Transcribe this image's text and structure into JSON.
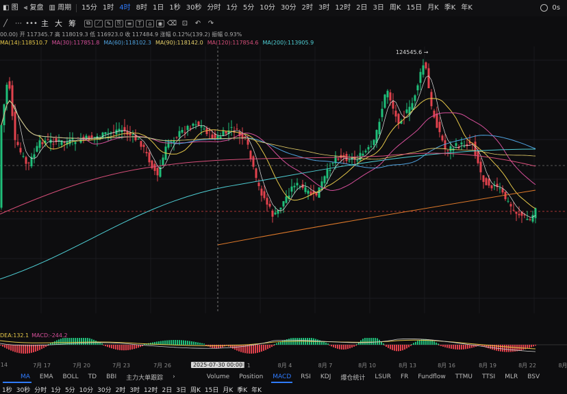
{
  "topbar": {
    "left_items": [
      "图",
      "复盘",
      "周期",
      "15分",
      "1时",
      "4时",
      "8时",
      "1日",
      "1秒",
      "30秒",
      "分时",
      "1分",
      "5分",
      "10分",
      "30分",
      "2时",
      "3时",
      "12时",
      "2日",
      "3日",
      "周K",
      "15日",
      "月K",
      "季K",
      "年K"
    ],
    "active": "4时",
    "right": "0s"
  },
  "toolbar": {
    "text_tools": [
      "主",
      "大",
      "筹"
    ]
  },
  "ohlc_line": "00.00) 开 117345.7 高 118019.3 低 116923.0 收 117484.9 涨幅 0.12%(139.2) 振幅 0.93%",
  "ma_legend": [
    {
      "label": "MA(14):118510.7",
      "color": "#e6c84a"
    },
    {
      "label": "MA(30):117851.8",
      "color": "#d64f9a"
    },
    {
      "label": "MA(60):118102.3",
      "color": "#4fa3e0"
    },
    {
      "label": "MA(90):118142.0",
      "color": "#e6d06a"
    },
    {
      "label": "MA(120):117854.6",
      "color": "#d84f7a"
    },
    {
      "label": "MA(200):113905.9",
      "color": "#4fd0d6"
    }
  ],
  "high_label": "124545.6",
  "macd_legend": [
    {
      "label": "DEA:132.1",
      "color": "#e6c84a"
    },
    {
      "label": "MACD:-244.2",
      "color": "#d64f9a"
    }
  ],
  "dates": [
    "14",
    "7月 17",
    "7月 20",
    "7月 23",
    "7月 26",
    "2025-07-30 00:00",
    "月 1",
    "8月 4",
    "8月 7",
    "8月 10",
    "8月 13",
    "8月 16",
    "8月 19",
    "8月 22",
    "8月"
  ],
  "indicators": [
    "MA",
    "EMA",
    "BOLL",
    "TD",
    "BBI",
    "主力大单跟踪",
    "›",
    "Volume",
    "Position",
    "MACD",
    "RSI",
    "KDJ",
    "爆仓统计",
    "LSUR",
    "FR",
    "Fundflow",
    "TTMU",
    "TTSI",
    "MLR",
    "BSV"
  ],
  "active_main_indicator": "MA",
  "active_sub_indicator": "MACD",
  "timeframes": [
    "1秒",
    "30秒",
    "分时",
    "1分",
    "5分",
    "10分",
    "30分",
    "2时",
    "3时",
    "12时",
    "2日",
    "3日",
    "周K",
    "15日",
    "月K",
    "季K",
    "年K"
  ],
  "colors": {
    "up": "#1fbf7a",
    "down": "#e2424d",
    "accent": "#2f7bff"
  }
}
